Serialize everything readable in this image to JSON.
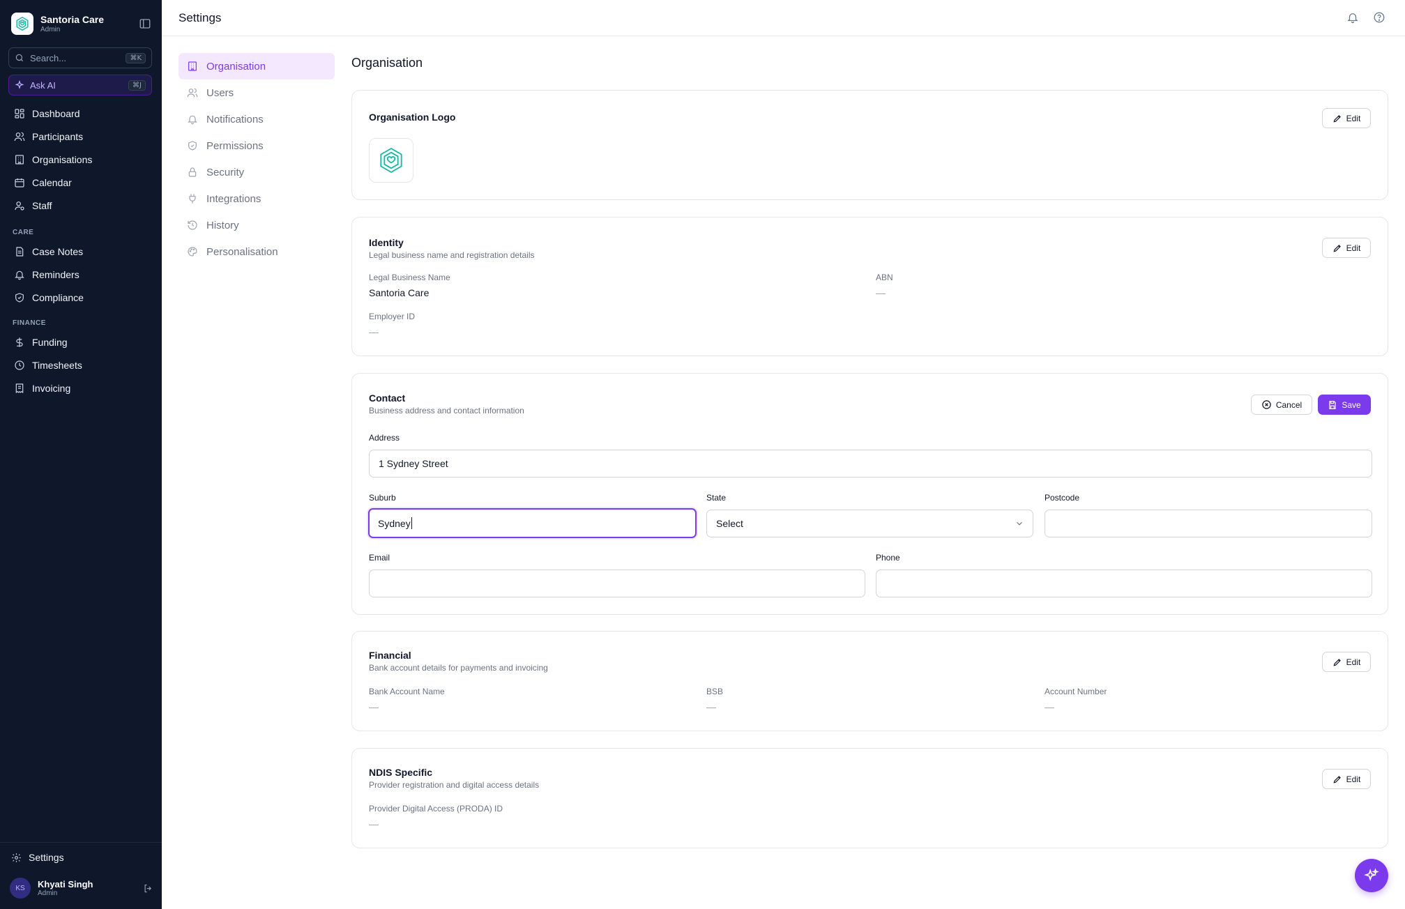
{
  "app": {
    "name": "Santoria Care",
    "role": "Admin"
  },
  "sidebar": {
    "search": {
      "label": "Search...",
      "shortcut": "⌘K"
    },
    "ask_ai": {
      "label": "Ask AI",
      "shortcut": "⌘J"
    },
    "main_items": [
      {
        "label": "Dashboard",
        "icon": "dashboard-icon"
      },
      {
        "label": "Participants",
        "icon": "users-icon"
      },
      {
        "label": "Organisations",
        "icon": "building-icon"
      },
      {
        "label": "Calendar",
        "icon": "calendar-icon"
      },
      {
        "label": "Staff",
        "icon": "staff-icon"
      }
    ],
    "care_title": "CARE",
    "care_items": [
      {
        "label": "Case Notes",
        "icon": "file-icon"
      },
      {
        "label": "Reminders",
        "icon": "bell-icon"
      },
      {
        "label": "Compliance",
        "icon": "shield-icon"
      }
    ],
    "finance_title": "FINANCE",
    "finance_items": [
      {
        "label": "Funding",
        "icon": "dollar-icon"
      },
      {
        "label": "Timesheets",
        "icon": "clock-icon"
      },
      {
        "label": "Invoicing",
        "icon": "receipt-icon"
      }
    ],
    "settings_label": "Settings",
    "user": {
      "initials": "KS",
      "name": "Khyati Singh",
      "role": "Admin"
    }
  },
  "header": {
    "title": "Settings"
  },
  "subnav": {
    "items": [
      {
        "label": "Organisation",
        "active": true
      },
      {
        "label": "Users"
      },
      {
        "label": "Notifications"
      },
      {
        "label": "Permissions"
      },
      {
        "label": "Security"
      },
      {
        "label": "Integrations"
      },
      {
        "label": "History"
      },
      {
        "label": "Personalisation"
      }
    ]
  },
  "main": {
    "section_title": "Organisation",
    "logo_card": {
      "title": "Organisation Logo",
      "edit_label": "Edit"
    },
    "identity": {
      "title": "Identity",
      "subtitle": "Legal business name and registration details",
      "edit_label": "Edit",
      "legal_name_label": "Legal Business Name",
      "legal_name_value": "Santoria Care",
      "abn_label": "ABN",
      "abn_value": "—",
      "employer_id_label": "Employer ID",
      "employer_id_value": "—"
    },
    "contact": {
      "title": "Contact",
      "subtitle": "Business address and contact information",
      "cancel_label": "Cancel",
      "save_label": "Save",
      "address_label": "Address",
      "address_value": "1 Sydney Street",
      "suburb_label": "Suburb",
      "suburb_value": "Sydney",
      "state_label": "State",
      "state_value": "Select",
      "postcode_label": "Postcode",
      "postcode_value": "",
      "email_label": "Email",
      "email_value": "",
      "phone_label": "Phone",
      "phone_value": ""
    },
    "financial": {
      "title": "Financial",
      "subtitle": "Bank account details for payments and invoicing",
      "edit_label": "Edit",
      "bank_name_label": "Bank Account Name",
      "bank_name_value": "—",
      "bsb_label": "BSB",
      "bsb_value": "—",
      "account_number_label": "Account Number",
      "account_number_value": "—"
    },
    "ndis": {
      "title": "NDIS Specific",
      "subtitle": "Provider registration and digital access details",
      "edit_label": "Edit",
      "proda_label": "Provider Digital Access (PRODA) ID",
      "proda_value": "—"
    }
  },
  "colors": {
    "sidebar_bg": "#0f172a",
    "accent": "#7c3aed",
    "logo_teal": "#14b8a6"
  }
}
